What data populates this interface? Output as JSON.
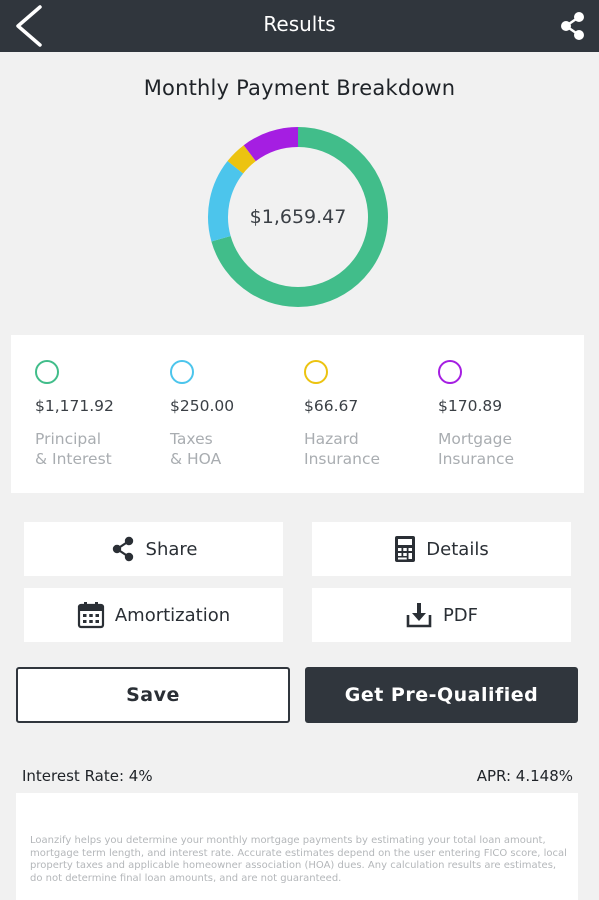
{
  "header": {
    "title": "Results",
    "back_icon": "chevron-left-icon",
    "share_icon": "share-icon"
  },
  "breakdown": {
    "title": "Monthly Payment Breakdown",
    "total": "$1,659.47"
  },
  "chart_data": {
    "type": "pie",
    "categories": [
      "Principal & Interest",
      "Taxes & HOA",
      "Hazard Insurance",
      "Mortgage Insurance"
    ],
    "values": [
      1171.92,
      250.0,
      66.67,
      170.89
    ],
    "colors": [
      "#41bd8a",
      "#4cc5ec",
      "#ecc310",
      "#a51ee2"
    ],
    "donut": true,
    "center_label": "$1,659.47"
  },
  "legend": [
    {
      "value": "$1,171.92",
      "label": "Principal\n& Interest",
      "color": "#41bd8a"
    },
    {
      "value": "$250.00",
      "label": "Taxes\n& HOA",
      "color": "#4cc5ec"
    },
    {
      "value": "$66.67",
      "label": "Hazard\nInsurance",
      "color": "#ecc310"
    },
    {
      "value": "$170.89",
      "label": "Mortgage\nInsurance",
      "color": "#a51ee2"
    }
  ],
  "actions": {
    "share": {
      "label": "Share",
      "icon": "share-icon"
    },
    "details": {
      "label": "Details",
      "icon": "calculator-icon"
    },
    "amortization": {
      "label": "Amortization",
      "icon": "calendar-icon"
    },
    "pdf": {
      "label": "PDF",
      "icon": "download-icon"
    }
  },
  "buttons": {
    "save": "Save",
    "prequalified": "Get Pre-Qualified"
  },
  "rates": {
    "interest": "Interest Rate: 4%",
    "apr": "APR: 4.148%"
  },
  "disclaimer": "Loanzify helps you determine your monthly mortgage payments by estimating your total loan amount, mortgage term length, and interest rate. Accurate estimates depend on the user entering FICO score, local property taxes and applicable homeowner association (HOA) dues. Any calculation results are estimates, do not determine final loan amounts, and are not guaranteed.",
  "theme": {
    "header_bg": "#30363d",
    "page_bg": "#f1f1f1"
  }
}
